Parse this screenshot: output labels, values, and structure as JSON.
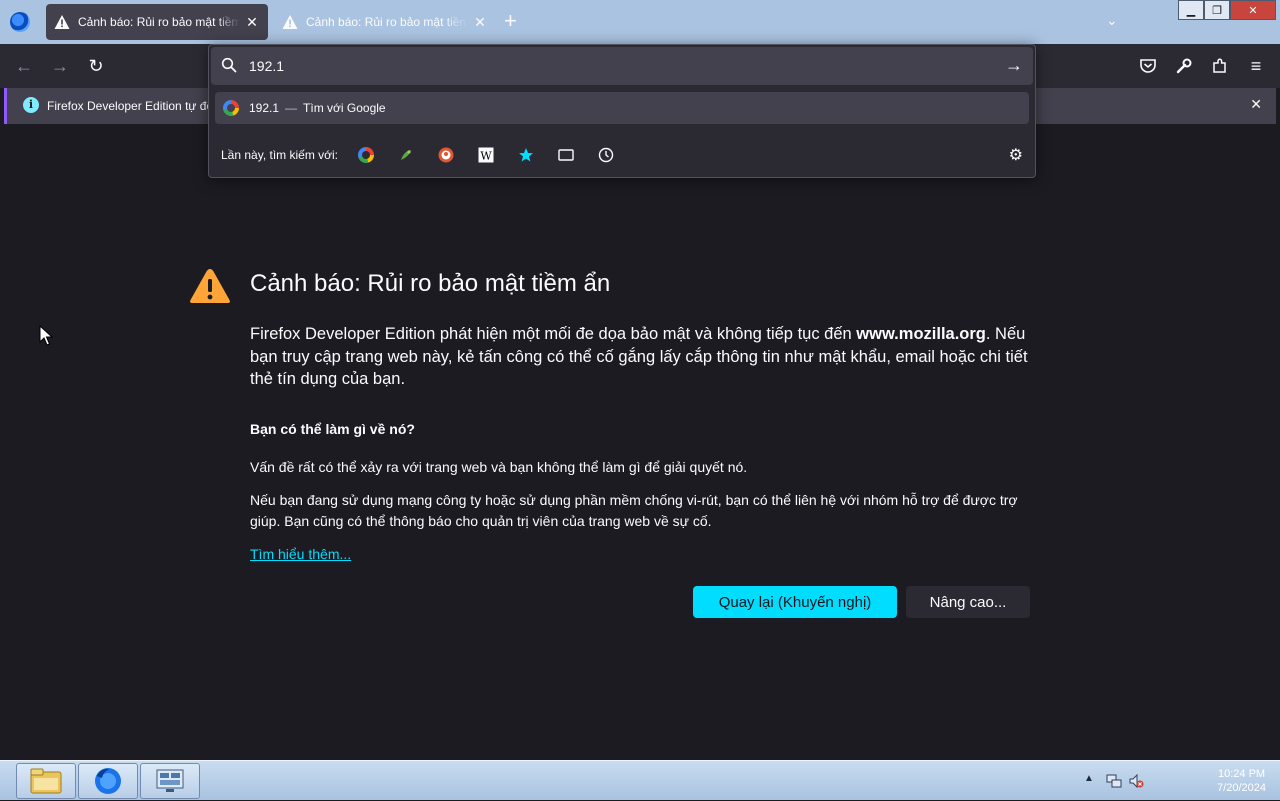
{
  "tabs": [
    {
      "title": "Cảnh báo: Rủi ro bảo mật tiềm ẩn",
      "active": true
    },
    {
      "title": "Cảnh báo: Rủi ro bảo mật tiềm ẩn",
      "active": false
    }
  ],
  "urlbar": {
    "value": "192.1",
    "suggestion_text": "192.1",
    "suggestion_separator": "—",
    "suggestion_action": "Tìm với Google",
    "oneoff_label": "Lần này, tìm kiếm với:",
    "engines": [
      "google-icon",
      "bookmarklet-icon",
      "duckduckgo-icon",
      "wikipedia-icon",
      "bookmarks-star-icon",
      "tabs-icon",
      "history-icon"
    ]
  },
  "notification": {
    "text": "Firefox Developer Edition tự độ"
  },
  "error": {
    "title": "Cảnh báo: Rủi ro bảo mật tiềm ẩn",
    "desc_before": "Firefox Developer Edition phát hiện một mối đe dọa bảo mật và không tiếp tục đến",
    "desc_domain": "www.mozilla.org",
    "desc_after": ". Nếu bạn truy cập trang web này, kẻ tấn công có thể cố gắng lấy cắp thông tin như mật khẩu, email hoặc chi tiết thẻ tín dụng của bạn.",
    "what_title": "Bạn có thể làm gì về nó?",
    "para1": "Vấn đề rất có thể xảy ra với trang web và bạn không thể làm gì để giải quyết nó.",
    "para2": "Nếu bạn đang sử dụng mạng công ty hoặc sử dụng phần mềm chống vi-rút, bạn có thể liên hệ với nhóm hỗ trợ để được trợ giúp. Bạn cũng có thể thông báo cho quản trị viên của trang web về sự cố.",
    "learn_more": "Tìm hiểu thêm...",
    "back_button": "Quay lại (Khuyến nghị)",
    "advanced_button": "Nâng cao..."
  },
  "taskbar": {
    "time": "10:24 PM",
    "date": "7/20/2024"
  },
  "colors": {
    "accent": "#00ddff",
    "page_bg": "#1c1b22",
    "warning": "#ffa436"
  }
}
